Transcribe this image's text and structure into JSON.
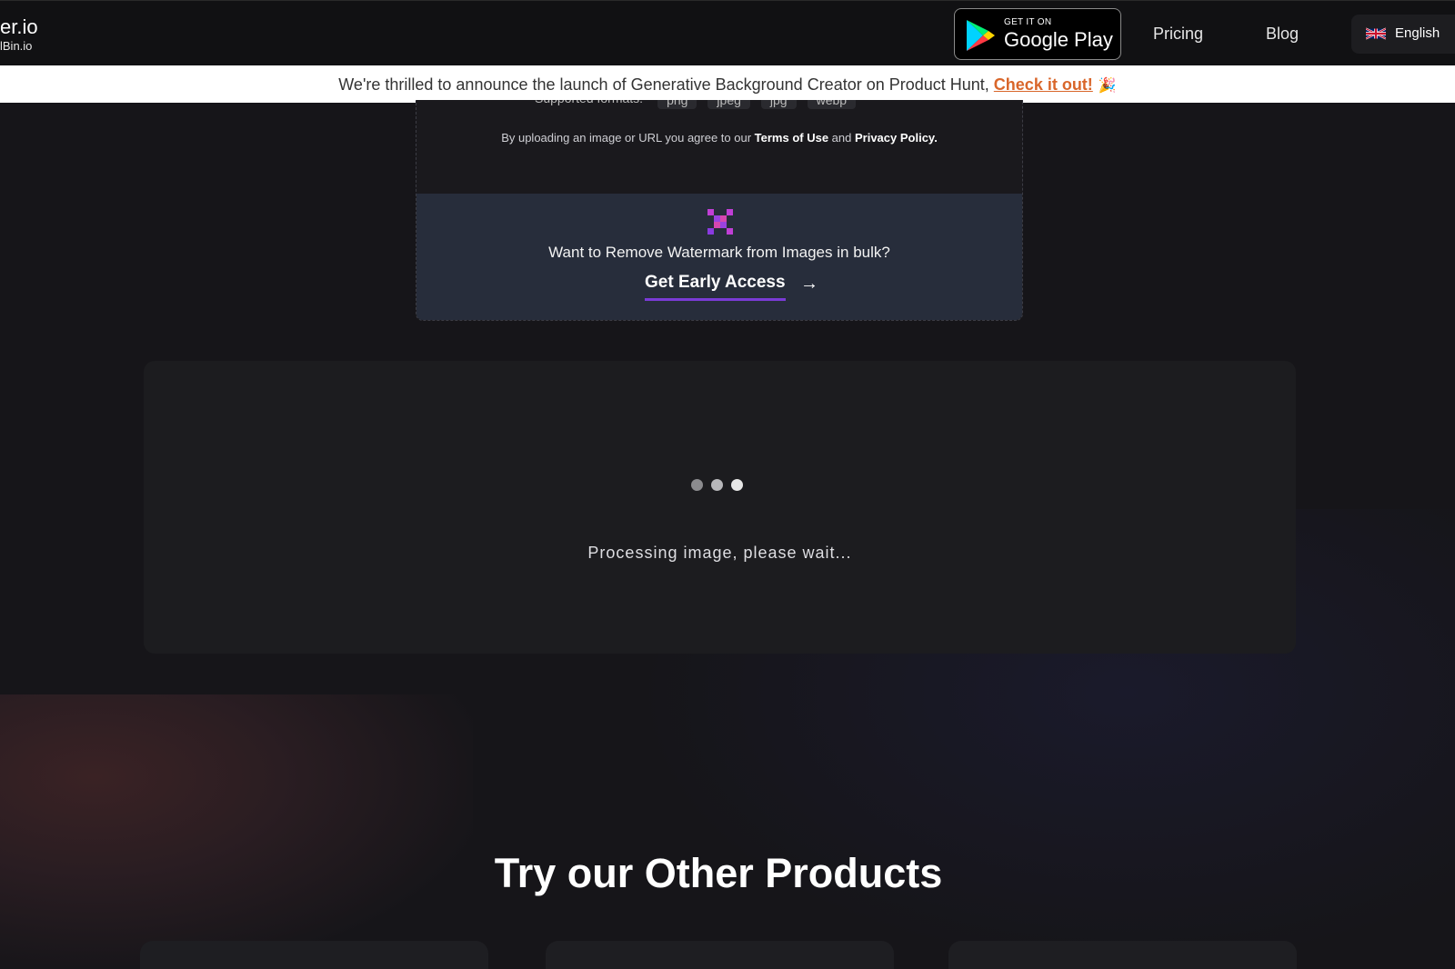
{
  "header": {
    "brand_main": "er.io",
    "brand_sub": "lBin.io",
    "google_play": {
      "small": "GET IT ON",
      "big": "Google Play"
    },
    "nav": {
      "pricing": "Pricing",
      "blog": "Blog"
    },
    "language": "English"
  },
  "announcement": {
    "text": "We're thrilled to announce the launch of Generative Background Creator on Product Hunt, ",
    "cta": "Check it out!",
    "emoji": "🎉"
  },
  "upload": {
    "formats_label": "Supported formats:",
    "formats": [
      "png",
      "jpeg",
      "jpg",
      "webp"
    ],
    "terms_prefix": "By uploading an image or URL you agree to our ",
    "terms_link": "Terms of Use",
    "terms_and": " and ",
    "privacy_link": "Privacy Policy."
  },
  "bulk": {
    "question": "Want to Remove Watermark from Images in bulk?",
    "cta": "Get Early Access",
    "arrow": "→"
  },
  "processing": {
    "text": "Processing image, please wait..."
  },
  "products": {
    "title": "Try our Other Products"
  },
  "colors": {
    "accent_orange": "#d9662a",
    "accent_purple": "#7a3bd6",
    "bulk_bg": "#272d3b"
  }
}
